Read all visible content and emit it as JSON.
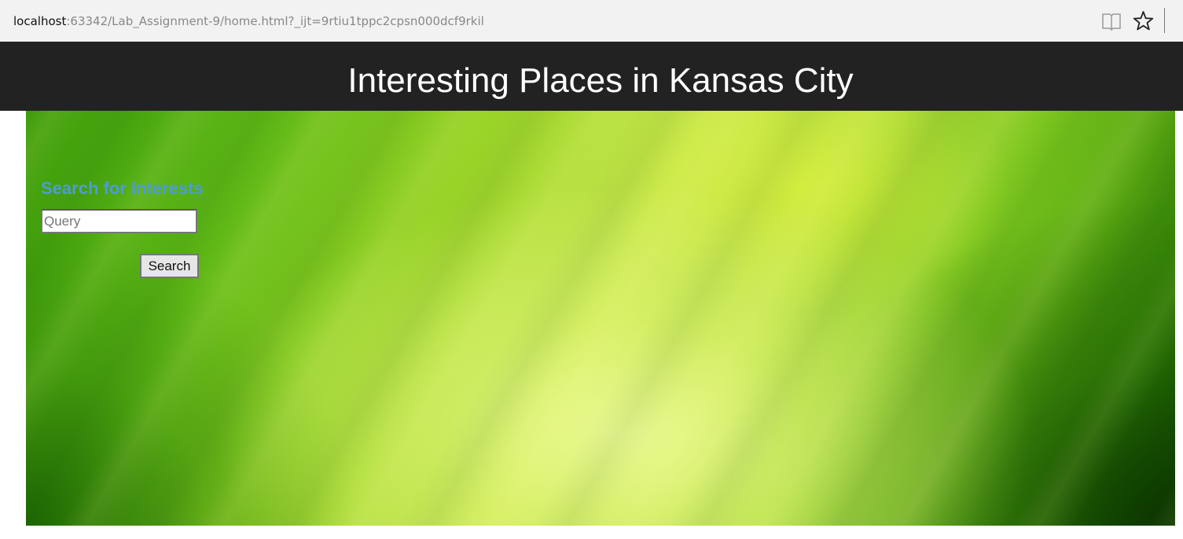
{
  "browser": {
    "url_host": "localhost",
    "url_rest": ":63342/Lab_Assignment-9/home.html?_ijt=9rtiu1tppc2cpsn000dcf9rkil",
    "icons": [
      "reading-view-icon",
      "favorite-star-icon"
    ]
  },
  "header": {
    "title": "Interesting Places in Kansas City"
  },
  "search": {
    "heading": "Search for Interests",
    "placeholder": "Query",
    "value": "",
    "button_label": "Search"
  },
  "colors": {
    "header_bg": "#222222",
    "heading_text": "#4f9bd8",
    "hero_green": "#7cc41e"
  }
}
